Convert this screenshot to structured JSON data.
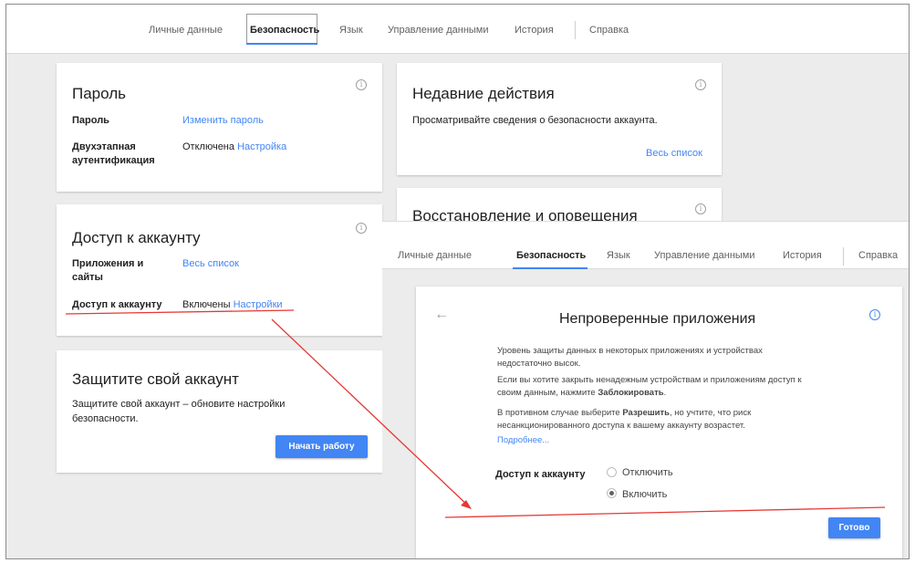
{
  "tabs": [
    "Личные данные",
    "Безопасность",
    "Язык",
    "Управление данными",
    "История",
    "Справка"
  ],
  "password_card": {
    "title": "Пароль",
    "password_label": "Пароль",
    "password_link": "Изменить пароль",
    "twofa_label": "Двухэтапная аутентификация",
    "twofa_status": "Отключена",
    "twofa_link": "Настройка"
  },
  "account_access_card": {
    "title": "Доступ к аккаунту",
    "apps_label": "Приложения и сайты",
    "apps_link": "Весь список",
    "access_label": "Доступ к аккаунту",
    "access_status": "Включены",
    "access_link": "Настройки"
  },
  "protect_card": {
    "title": "Защитите свой аккаунт",
    "text": "Защитите свой аккаунт – обновите настройки безопасности.",
    "button": "Начать работу"
  },
  "recent_card": {
    "title": "Недавние действия",
    "text": "Просматривайте сведения о безопасности аккаунта.",
    "link": "Весь список"
  },
  "recovery_card": {
    "title": "Восстановление и оповещения"
  },
  "dialog": {
    "title": "Непроверенные приложения",
    "para1": "Уровень защиты данных в некоторых приложениях и устройствах недостаточно высок.",
    "para2_prefix": "Если вы хотите закрыть ненадежным устройствам и приложениям доступ к своим данным, нажмите ",
    "para2_bold": "Заблокировать",
    "para2_suffix": ".",
    "para3_prefix": "В противном случае выберите ",
    "para3_bold": "Разрешить",
    "para3_suffix": ", но учтите, что риск несанкционированного доступа к вашему аккаунту возрастет.",
    "more_link": "Подробнее...",
    "access_label": "Доступ к аккаунту",
    "option_off": "Отключить",
    "option_on": "Включить",
    "selected": "Включить",
    "done_button": "Готово"
  },
  "colors": {
    "accent": "#4285f4",
    "annotation": "#e53935"
  }
}
